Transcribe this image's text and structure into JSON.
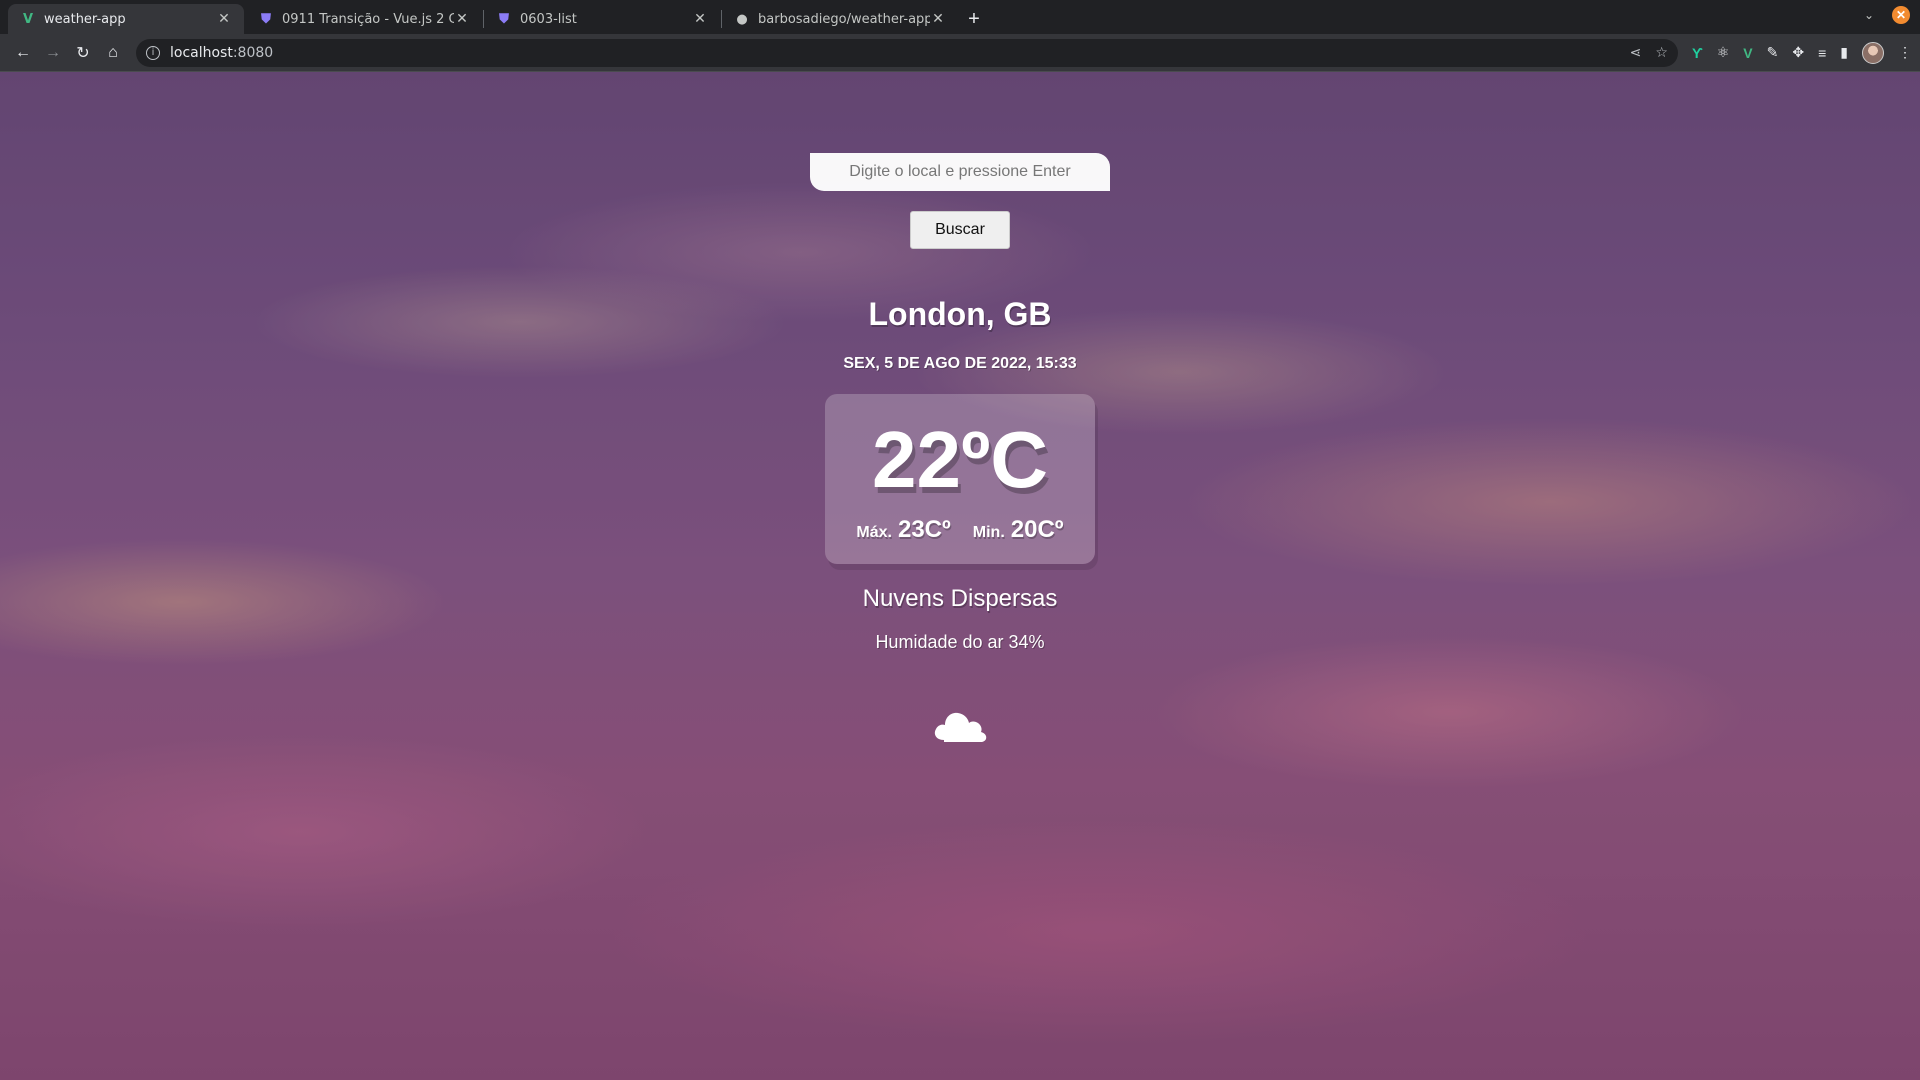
{
  "browser": {
    "tabs": [
      {
        "title": "weather-app",
        "icon": "vue-logo-icon"
      },
      {
        "title": "0911 Transição - Vue.js 2 Comp",
        "icon": "shield-favicon-icon"
      },
      {
        "title": "0603-list",
        "icon": "shield-favicon-icon"
      },
      {
        "title": "barbosadiego/weather-app-",
        "icon": "github-icon"
      }
    ],
    "url_host": "localhost",
    "url_port": ":8080"
  },
  "app": {
    "search_placeholder": "Digite o local e pressione Enter",
    "search_button": "Buscar",
    "location": "London, GB",
    "date": "SEX, 5 DE AGO DE 2022, 15:33",
    "temperature": "22ºC",
    "max_label": "Máx.",
    "max_value": "23Cº",
    "min_label": "Min.",
    "min_value": "20Cº",
    "description": "Nuvens Dispersas",
    "humidity": "Humidade do ar 34%",
    "weather_icon": "cloud-icon"
  }
}
